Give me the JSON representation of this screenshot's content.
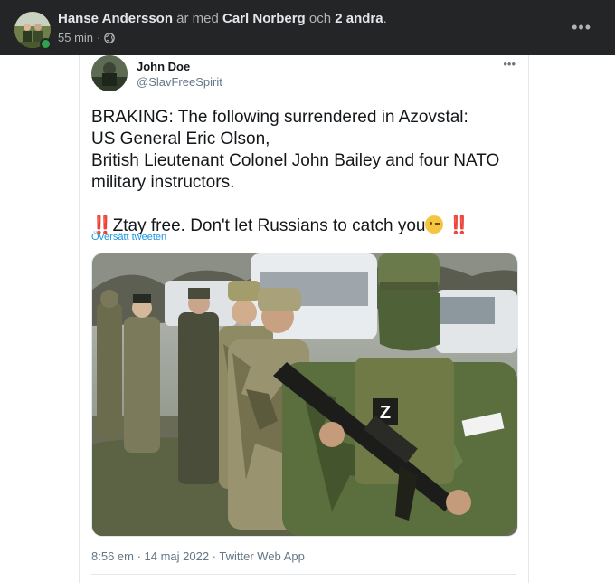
{
  "post": {
    "author": "Hanse Andersson",
    "with_text": "är med",
    "tagged_person": "Carl Norberg",
    "and_text": "och",
    "others": "2 andra",
    "period": ".",
    "time": "55 min",
    "separator": "·",
    "privacy_icon": "globe-icon",
    "more_icon": "more-horizontal-icon",
    "more_glyph": "•••",
    "header_bg": "#242526",
    "online_color": "#31a24c"
  },
  "tweet": {
    "name": "John Doe",
    "handle": "@SlavFreeSpirit",
    "more_glyph": "•••",
    "text_lines": [
      "BRAKING: The following surrendered in Azovstal:",
      "US General Eric Olson,",
      "British Lieutenant Colonel John Bailey and four NATO",
      "military instructors."
    ],
    "bang": "‼️",
    "tagline": "Ztay free. Don't let Russians to catch you",
    "emoji": "winking-face-icon",
    "translate": "Översätt tweeten",
    "meta": "8:56 em · 14 maj 2022 · Twitter Web App",
    "link_color": "#1b95e0"
  }
}
